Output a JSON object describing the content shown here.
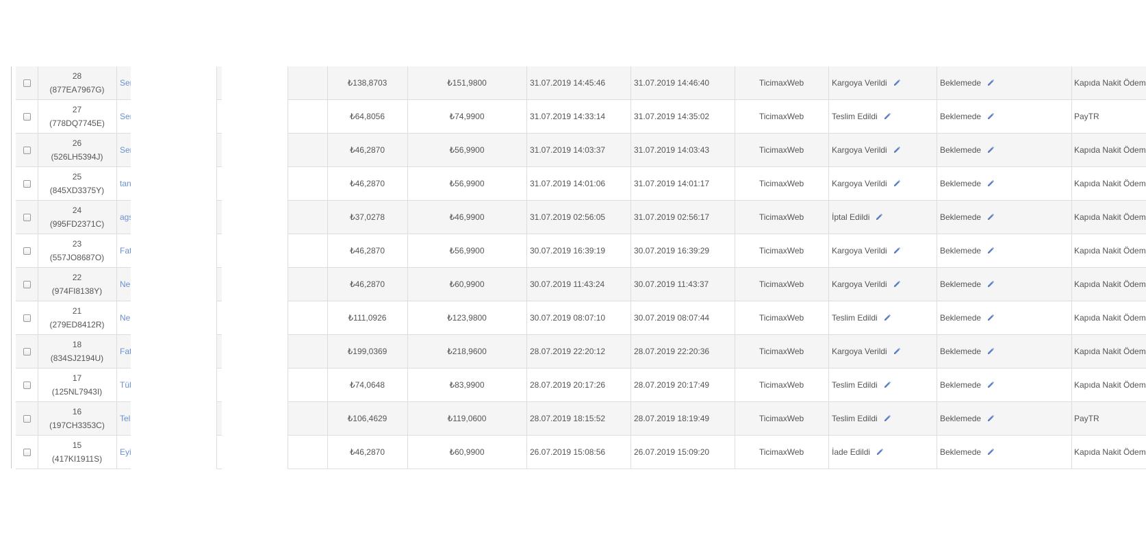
{
  "orders": [
    {
      "id": "28",
      "code": "(877EA7967G)",
      "customer": "Ser",
      "cost": "₺138,8703",
      "total": "₺151,9800",
      "date1": "31.07.2019 14:45:46",
      "date2": "31.07.2019 14:46:40",
      "source": "TicimaxWeb",
      "status": "Kargoya Verildi",
      "payment_status": "Beklemede",
      "payment": "Kapıda Nakit Ödem"
    },
    {
      "id": "27",
      "code": "(778DQ7745E)",
      "customer": "Ser",
      "cost": "₺64,8056",
      "total": "₺74,9900",
      "date1": "31.07.2019 14:33:14",
      "date2": "31.07.2019 14:35:02",
      "source": "TicimaxWeb",
      "status": "Teslim Edildi",
      "payment_status": "Beklemede",
      "payment": "PayTR"
    },
    {
      "id": "26",
      "code": "(526LH5394J)",
      "customer": "Ser",
      "cost": "₺46,2870",
      "total": "₺56,9900",
      "date1": "31.07.2019 14:03:37",
      "date2": "31.07.2019 14:03:43",
      "source": "TicimaxWeb",
      "status": "Kargoya Verildi",
      "payment_status": "Beklemede",
      "payment": "Kapıda Nakit Ödem"
    },
    {
      "id": "25",
      "code": "(845XD3375Y)",
      "customer": "tan",
      "cost": "₺46,2870",
      "total": "₺56,9900",
      "date1": "31.07.2019 14:01:06",
      "date2": "31.07.2019 14:01:17",
      "source": "TicimaxWeb",
      "status": "Kargoya Verildi",
      "payment_status": "Beklemede",
      "payment": "Kapıda Nakit Ödem"
    },
    {
      "id": "24",
      "code": "(995FD2371C)",
      "customer": "ags",
      "cost": "₺37,0278",
      "total": "₺46,9900",
      "date1": "31.07.2019 02:56:05",
      "date2": "31.07.2019 02:56:17",
      "source": "TicimaxWeb",
      "status": "İptal Edildi",
      "payment_status": "Beklemede",
      "payment": "Kapıda Nakit Ödem"
    },
    {
      "id": "23",
      "code": "(557JO8687O)",
      "customer": "Fat",
      "cost": "₺46,2870",
      "total": "₺56,9900",
      "date1": "30.07.2019 16:39:19",
      "date2": "30.07.2019 16:39:29",
      "source": "TicimaxWeb",
      "status": "Kargoya Verildi",
      "payment_status": "Beklemede",
      "payment": "Kapıda Nakit Ödem"
    },
    {
      "id": "22",
      "code": "(974FI8138Y)",
      "customer": "Ne",
      "cost": "₺46,2870",
      "total": "₺60,9900",
      "date1": "30.07.2019 11:43:24",
      "date2": "30.07.2019 11:43:37",
      "source": "TicimaxWeb",
      "status": "Kargoya Verildi",
      "payment_status": "Beklemede",
      "payment": "Kapıda Nakit Ödem"
    },
    {
      "id": "21",
      "code": "(279ED8412R)",
      "customer": "Ne",
      "cost": "₺111,0926",
      "total": "₺123,9800",
      "date1": "30.07.2019 08:07:10",
      "date2": "30.07.2019 08:07:44",
      "source": "TicimaxWeb",
      "status": "Teslim Edildi",
      "payment_status": "Beklemede",
      "payment": "Kapıda Nakit Ödem"
    },
    {
      "id": "18",
      "code": "(834SJ2194U)",
      "customer": "Fat",
      "cost": "₺199,0369",
      "total": "₺218,9600",
      "date1": "28.07.2019 22:20:12",
      "date2": "28.07.2019 22:20:36",
      "source": "TicimaxWeb",
      "status": "Kargoya Verildi",
      "payment_status": "Beklemede",
      "payment": "Kapıda Nakit Ödem"
    },
    {
      "id": "17",
      "code": "(125NL7943I)",
      "customer": "Tül",
      "cost": "₺74,0648",
      "total": "₺83,9900",
      "date1": "28.07.2019 20:17:26",
      "date2": "28.07.2019 20:17:49",
      "source": "TicimaxWeb",
      "status": "Teslim Edildi",
      "payment_status": "Beklemede",
      "payment": "Kapıda Nakit Ödem"
    },
    {
      "id": "16",
      "code": "(197CH3353C)",
      "customer": "Tel",
      "cost": "₺106,4629",
      "total": "₺119,0600",
      "date1": "28.07.2019 18:15:52",
      "date2": "28.07.2019 18:19:49",
      "source": "TicimaxWeb",
      "status": "Teslim Edildi",
      "payment_status": "Beklemede",
      "payment": "PayTR"
    },
    {
      "id": "15",
      "code": "(417KI1911S)",
      "customer": "Eyi",
      "cost": "₺46,2870",
      "total": "₺60,9900",
      "date1": "26.07.2019 15:08:56",
      "date2": "26.07.2019 15:09:20",
      "source": "TicimaxWeb",
      "status": "İade Edildi",
      "payment_status": "Beklemede",
      "payment": "Kapıda Nakit Ödem"
    }
  ],
  "icons": {
    "edit": "pencil-icon",
    "select": "checkbox"
  },
  "colors": {
    "link": "#6b8fd0",
    "pencil": "#5b7fc7",
    "stripe": "#f5f5f5",
    "border": "#dddddd",
    "text": "#555555"
  }
}
